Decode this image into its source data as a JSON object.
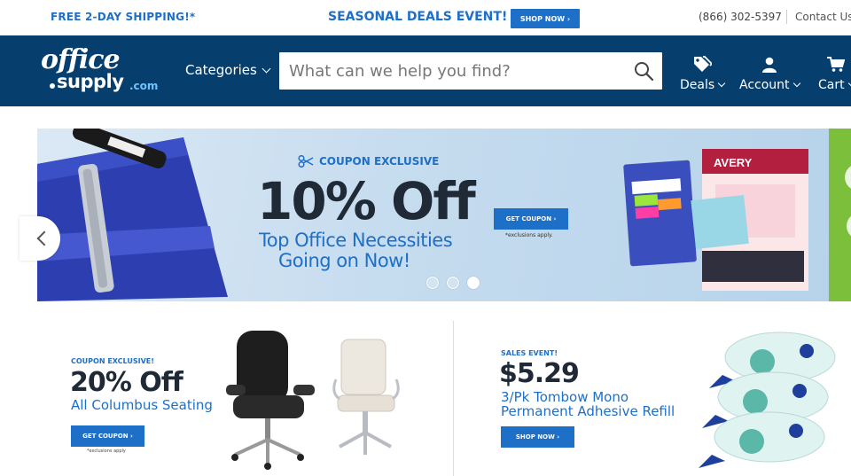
{
  "topbar": {
    "shipping": "FREE 2-DAY SHIPPING!*",
    "seasonal": "SEASONAL DEALS EVENT!",
    "shop_now": "SHOP NOW ›",
    "phone": "(866) 302-5397",
    "contact": "Contact Us"
  },
  "header": {
    "logo": {
      "line1": "office",
      "line2": "supply",
      "line3": ".com"
    },
    "categories": "Categories",
    "search_placeholder": "What can we help you find?",
    "deals": "Deals",
    "account": "Account",
    "cart": "Cart"
  },
  "hero": {
    "badge": "COUPON EXCLUSIVE",
    "headline": "10% Off",
    "sub1": "Top Office Necessities",
    "sub2": "Going on Now!",
    "button": "GET COUPON ›",
    "exclusions": "*exclusions apply.",
    "active_slide": 3,
    "slide_count": 3
  },
  "promo1": {
    "label": "COUPON EXCLUSIVE!",
    "headline": "20% Off",
    "sub": "All Columbus Seating",
    "button": "GET COUPON ›",
    "exclusions": "*exclusions apply"
  },
  "promo2": {
    "label": "SALES EVENT!",
    "headline": "$5.29",
    "sub1": "3/Pk Tombow Mono",
    "sub2": "Permanent Adhesive Refill",
    "button": "SHOP NOW ›"
  },
  "colors": {
    "brand_navy": "#063f6e",
    "accent_blue": "#1e6fc7",
    "side_green": "#7bbf3a"
  }
}
